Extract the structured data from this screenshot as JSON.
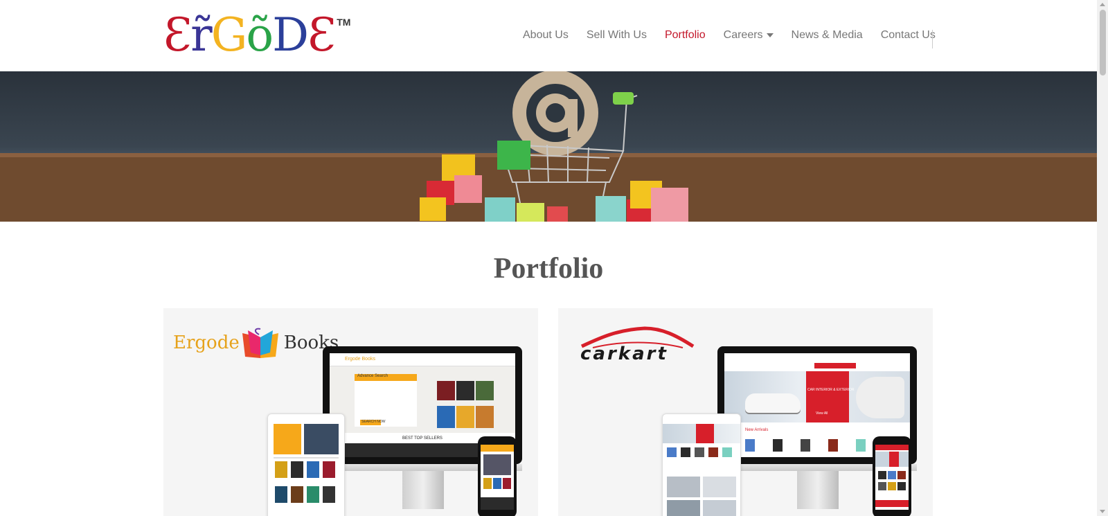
{
  "logo": {
    "letters": [
      {
        "char": "Ɛ",
        "color": "#c3172a"
      },
      {
        "char": "r̃",
        "color": "#3a3596"
      },
      {
        "char": "G",
        "color": "#f3b321"
      },
      {
        "char": "õ",
        "color": "#2aa348"
      },
      {
        "char": "D",
        "color": "#2b3f9a"
      },
      {
        "char": "Ɛ",
        "color": "#c3172a"
      }
    ],
    "trademark": "TM"
  },
  "nav": {
    "items": [
      {
        "label": "About Us",
        "active": false
      },
      {
        "label": "Sell With Us",
        "active": false
      },
      {
        "label": "Portfolio",
        "active": true
      },
      {
        "label": "Careers",
        "active": false,
        "dropdown": true
      },
      {
        "label": "News & Media",
        "active": false
      },
      {
        "label": "Contact Us",
        "active": false
      }
    ]
  },
  "hero": {
    "image_subject": "shopping cart with @ symbol and colored blocks on wooden table"
  },
  "page": {
    "title": "Portfolio"
  },
  "cards": {
    "books": {
      "brand_prefix": "Ergode",
      "brand_suffix": "Books",
      "screen": {
        "logo": "Ergode Books",
        "search_title": "Advance Search",
        "search_button": "SEARCH NOW",
        "section_title": "BEST TOP SELLERS",
        "menu": [
          "KEYWORDS",
          "TITLE",
          "AUTHOR"
        ]
      }
    },
    "carkart": {
      "brand": "carkart",
      "screen": {
        "tagline": "CarKart Provide Accessories to make Your Own Style For",
        "headline": "CAR INTERIOR & EXTERIOR",
        "coupon": "Coupon code - SAVENOW",
        "cta": "View All",
        "section_title": "New Arrivals"
      }
    }
  },
  "colors": {
    "accent": "#c3172a",
    "nav_text": "#777777",
    "card_bg": "#f5f5f5",
    "books_orange": "#f6a81a",
    "carkart_red": "#d71f2a"
  }
}
